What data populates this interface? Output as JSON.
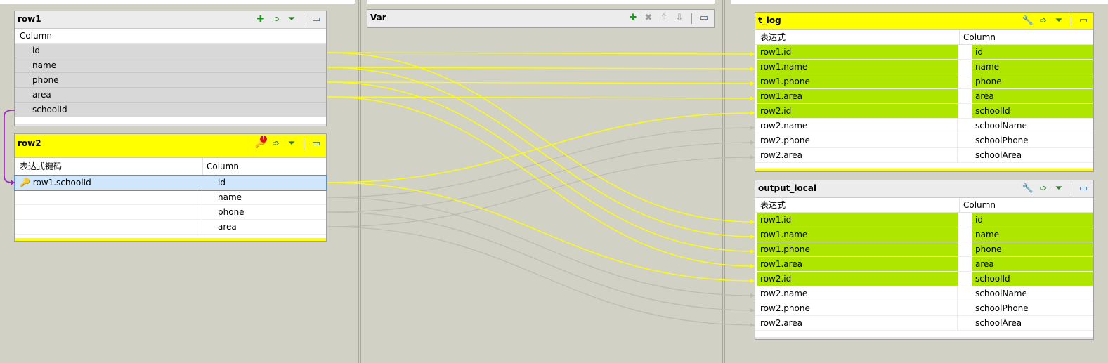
{
  "colors": {
    "link": "#ffff00",
    "link_faded": "#bdbbb0",
    "join_link": "#a020c0",
    "green": "#aee600",
    "header_yellow": "#ffff00"
  },
  "row1": {
    "title": "row1",
    "header": "Column",
    "rows": [
      "id",
      "name",
      "phone",
      "area",
      "schoolId"
    ],
    "icons": [
      "add-column-icon",
      "auto-map-icon",
      "filter-icon",
      "minimize-icon"
    ]
  },
  "row2": {
    "title": "row2",
    "header_expr": "表达式键码",
    "header_col": "Column",
    "rows": [
      {
        "expr": "row1.schoolId",
        "col": "id"
      },
      {
        "expr": "",
        "col": "name"
      },
      {
        "expr": "",
        "col": "phone"
      },
      {
        "expr": "",
        "col": "area"
      }
    ],
    "badge": "!",
    "icons": [
      "key-warning-icon",
      "auto-map-icon",
      "filter-icon",
      "minimize-icon"
    ]
  },
  "var": {
    "title": "Var",
    "icons": [
      "add-icon",
      "remove-icon",
      "move-up-icon",
      "move-down-icon",
      "minimize-icon"
    ]
  },
  "t_log": {
    "title": "t_log",
    "header_expr": "表达式",
    "header_col": "Column",
    "rows": [
      {
        "expr": "row1.id",
        "col": "id",
        "hl": true
      },
      {
        "expr": "row1.name",
        "col": "name",
        "hl": true
      },
      {
        "expr": "row1.phone",
        "col": "phone",
        "hl": true
      },
      {
        "expr": "row1.area",
        "col": "area",
        "hl": true
      },
      {
        "expr": "row2.id",
        "col": "schoolId",
        "hl": true
      },
      {
        "expr": "row2.name",
        "col": "schoolName",
        "hl": false
      },
      {
        "expr": "row2.phone",
        "col": "schoolPhone",
        "hl": false
      },
      {
        "expr": "row2.area",
        "col": "schoolArea",
        "hl": false
      }
    ],
    "icons": [
      "wrench-icon",
      "auto-map-icon",
      "filter-icon",
      "minimize-icon"
    ]
  },
  "output_local": {
    "title": "output_local",
    "header_expr": "表达式",
    "header_col": "Column",
    "rows": [
      {
        "expr": "row1.id",
        "col": "id",
        "hl": true
      },
      {
        "expr": "row1.name",
        "col": "name",
        "hl": true
      },
      {
        "expr": "row1.phone",
        "col": "phone",
        "hl": true
      },
      {
        "expr": "row1.area",
        "col": "area",
        "hl": true
      },
      {
        "expr": "row2.id",
        "col": "schoolId",
        "hl": true
      },
      {
        "expr": "row2.name",
        "col": "schoolName",
        "hl": false
      },
      {
        "expr": "row2.phone",
        "col": "schoolPhone",
        "hl": false
      },
      {
        "expr": "row2.area",
        "col": "schoolArea",
        "hl": false
      }
    ],
    "icons": [
      "wrench-icon",
      "auto-map-icon",
      "filter-icon",
      "minimize-icon"
    ]
  }
}
